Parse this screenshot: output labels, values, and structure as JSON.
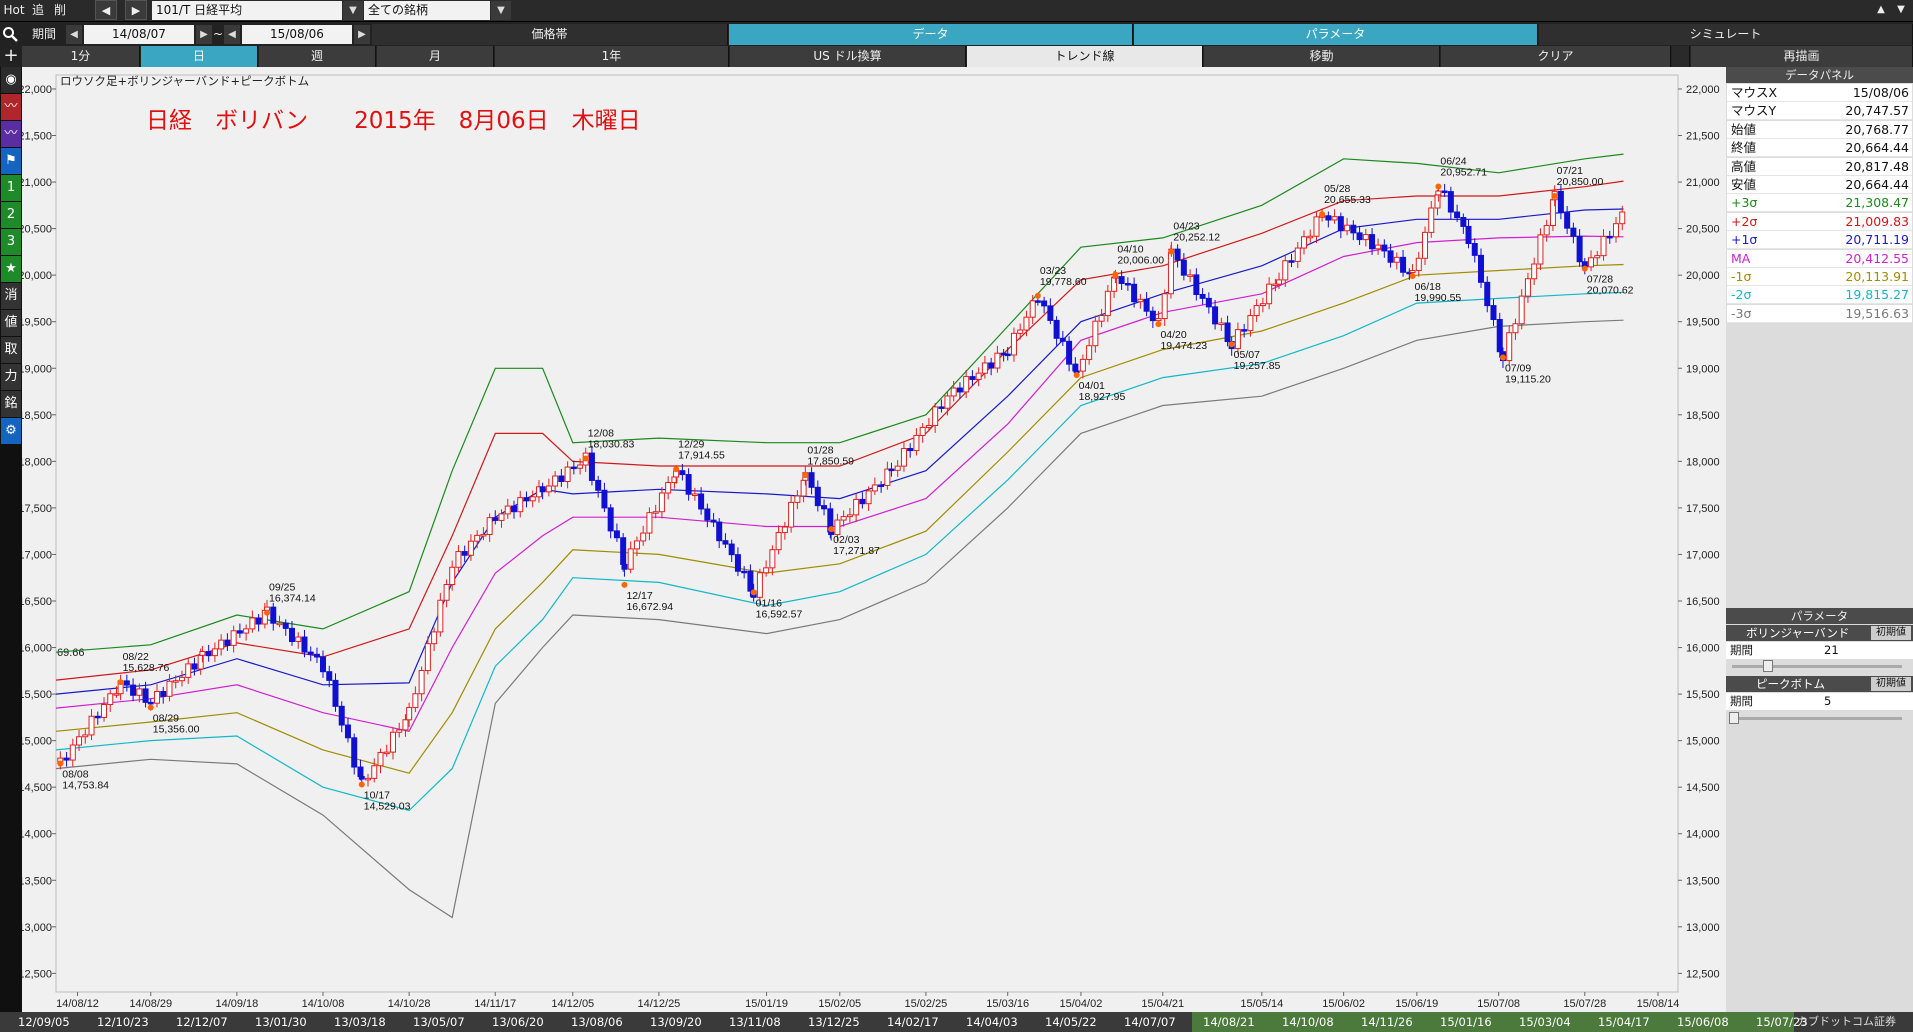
{
  "toolbar": {
    "hot": "Hot",
    "add": "追",
    "del": "削",
    "symbol": "101/T 日経平均",
    "universe": "全ての銘柄",
    "period_label": "期間",
    "date_from": "14/08/07",
    "tilde": "~",
    "date_to": "15/08/06",
    "tab_price": "価格帯",
    "tab_data": "データ",
    "tab_param": "パラメータ",
    "tab_sim": "シミュレート",
    "interval_1min": "1分",
    "interval_day": "日",
    "interval_week": "週",
    "interval_month": "月",
    "range_1y": "1年",
    "usd": "US ドル換算",
    "trendline": "トレンド線",
    "move": "移動",
    "clear": "クリア",
    "redraw": "再描画"
  },
  "leftbar": [
    "消",
    "値",
    "取",
    "力",
    "銘"
  ],
  "chart_data": {
    "type": "candlestick",
    "title": "ロウソク足+ボリンジャーバンド+ピークボトム",
    "annotation": "日経　ボリバン　　2015年　8月06日　木曜日",
    "y_ticks": [
      22000,
      21500,
      21000,
      20500,
      20000,
      19500,
      19000,
      18500,
      18000,
      17500,
      17000,
      16500,
      16000,
      15500,
      15000,
      14500,
      14000,
      13500,
      13000,
      12500
    ],
    "y_range": [
      12300,
      22150
    ],
    "y_cutoff_label": "69.66",
    "x_ticks": [
      "14/08/12",
      "14/08/29",
      "14/09/18",
      "14/10/08",
      "14/10/28",
      "14/11/17",
      "14/12/05",
      "14/12/25",
      "15/01/19",
      "15/02/05",
      "15/02/25",
      "15/03/16",
      "15/04/02",
      "15/04/21",
      "15/05/14",
      "15/06/02",
      "15/06/19",
      "15/07/08",
      "15/07/28",
      "15/08/14"
    ],
    "bands": {
      "names": [
        "+3σ",
        "+2σ",
        "+1σ",
        "MA",
        "-1σ",
        "-2σ",
        "-3σ"
      ],
      "colors": [
        "#1a8a1a",
        "#d01818",
        "#1a1ac8",
        "#d020d0",
        "#a08c00",
        "#10b8c8",
        "#7a7a7a"
      ],
      "anchors_x": [
        "14/08/07",
        "14/08/29",
        "14/09/18",
        "14/10/08",
        "14/10/28",
        "14/11/07",
        "14/11/17",
        "14/11/28",
        "14/12/05",
        "14/12/25",
        "15/01/19",
        "15/02/05",
        "15/02/25",
        "15/03/16",
        "15/04/02",
        "15/04/21",
        "15/05/14",
        "15/06/02",
        "15/06/19",
        "15/07/08",
        "15/07/28",
        "15/08/06"
      ],
      "plus3": [
        15950,
        16030,
        16350,
        16200,
        16600,
        17900,
        19000,
        19000,
        18200,
        18250,
        18200,
        18200,
        18500,
        19450,
        20300,
        20400,
        20750,
        21250,
        21200,
        21100,
        21250,
        21300
      ],
      "plus2": [
        15650,
        15760,
        16050,
        15900,
        16200,
        17200,
        18300,
        18300,
        18000,
        17950,
        17950,
        17950,
        18300,
        19200,
        19950,
        20100,
        20450,
        20800,
        20850,
        20850,
        20950,
        21010
      ],
      "plus1": [
        15500,
        15600,
        15880,
        15600,
        15620,
        16700,
        17400,
        17700,
        17650,
        17700,
        17650,
        17600,
        17900,
        18700,
        19500,
        19800,
        20100,
        20500,
        20600,
        20600,
        20700,
        20711
      ],
      "ma": [
        15350,
        15450,
        15600,
        15300,
        15100,
        16000,
        16800,
        17200,
        17400,
        17400,
        17300,
        17300,
        17600,
        18400,
        19300,
        19600,
        19800,
        20200,
        20350,
        20400,
        20420,
        20412
      ],
      "minus1": [
        15100,
        15200,
        15300,
        14900,
        14650,
        15300,
        16200,
        16700,
        17050,
        17000,
        16800,
        16900,
        17250,
        18100,
        18900,
        19200,
        19400,
        19700,
        20000,
        20050,
        20100,
        20114
      ],
      "minus2": [
        14900,
        15000,
        15050,
        14500,
        14250,
        14700,
        15800,
        16300,
        16750,
        16700,
        16450,
        16600,
        17000,
        17800,
        18600,
        18900,
        19050,
        19350,
        19700,
        19750,
        19800,
        19815
      ],
      "minus3": [
        14700,
        14800,
        14750,
        14200,
        13400,
        13100,
        15400,
        16000,
        16350,
        16300,
        16150,
        16300,
        16700,
        17500,
        18300,
        18600,
        18700,
        19000,
        19300,
        19450,
        19500,
        19516
      ]
    },
    "price": {
      "x": [
        "14/08/08",
        "14/08/22",
        "14/08/29",
        "14/09/10",
        "14/09/25",
        "14/10/08",
        "14/10/17",
        "14/10/28",
        "14/11/07",
        "14/11/17",
        "14/11/28",
        "14/12/08",
        "14/12/17",
        "14/12/29",
        "15/01/08",
        "15/01/16",
        "15/01/28",
        "15/02/03",
        "15/02/17",
        "15/03/02",
        "15/03/16",
        "15/03/23",
        "15/04/01",
        "15/04/10",
        "15/04/20",
        "15/04/23",
        "15/05/07",
        "15/05/18",
        "15/05/28",
        "15/06/10",
        "15/06/18",
        "15/06/24",
        "15/07/01",
        "15/07/09",
        "15/07/21",
        "15/07/28",
        "15/08/06"
      ],
      "close": [
        14753,
        15620,
        15420,
        15900,
        16374,
        15800,
        14529,
        15300,
        16900,
        17400,
        17700,
        18030,
        16900,
        17914,
        17200,
        16592,
        17850,
        17271,
        17900,
        18700,
        19200,
        19778,
        18927,
        20006,
        19474,
        20252,
        19257,
        20000,
        20655,
        20300,
        19990,
        20952,
        20400,
        19115,
        20850,
        20070,
        20664
      ]
    },
    "markers": [
      {
        "label": "08/08",
        "value": "14,753.84",
        "x": "14/08/08",
        "y": 14753.84,
        "type": "bottom"
      },
      {
        "label": "08/22",
        "value": "15,628.76",
        "x": "14/08/22",
        "y": 15628.76,
        "type": "top"
      },
      {
        "label": "08/29",
        "value": "15,356.00",
        "x": "14/08/29",
        "y": 15356.0,
        "type": "bottom"
      },
      {
        "label": "09/25",
        "value": "16,374.14",
        "x": "14/09/25",
        "y": 16374.14,
        "type": "top"
      },
      {
        "label": "10/17",
        "value": "14,529.03",
        "x": "14/10/17",
        "y": 14529.03,
        "type": "bottom"
      },
      {
        "label": "12/08",
        "value": "18,030.83",
        "x": "14/12/08",
        "y": 18030.83,
        "type": "top"
      },
      {
        "label": "12/17",
        "value": "16,672.94",
        "x": "14/12/17",
        "y": 16672.94,
        "type": "bottom"
      },
      {
        "label": "12/29",
        "value": "17,914.55",
        "x": "14/12/29",
        "y": 17914.55,
        "type": "top"
      },
      {
        "label": "01/16",
        "value": "16,592.57",
        "x": "15/01/16",
        "y": 16592.57,
        "type": "bottom"
      },
      {
        "label": "01/28",
        "value": "17,850.59",
        "x": "15/01/28",
        "y": 17850.59,
        "type": "top"
      },
      {
        "label": "02/03",
        "value": "17,271.87",
        "x": "15/02/03",
        "y": 17271.87,
        "type": "bottom"
      },
      {
        "label": "03/23",
        "value": "19,778.60",
        "x": "15/03/23",
        "y": 19778.6,
        "type": "top"
      },
      {
        "label": "04/01",
        "value": "18,927.95",
        "x": "15/04/01",
        "y": 18927.95,
        "type": "bottom"
      },
      {
        "label": "04/10",
        "value": "20,006.00",
        "x": "15/04/10",
        "y": 20006.0,
        "type": "top"
      },
      {
        "label": "04/20",
        "value": "19,474.23",
        "x": "15/04/20",
        "y": 19474.23,
        "type": "bottom"
      },
      {
        "label": "04/23",
        "value": "20,252.12",
        "x": "15/04/23",
        "y": 20252.12,
        "type": "top"
      },
      {
        "label": "05/07",
        "value": "19,257.85",
        "x": "15/05/07",
        "y": 19257.85,
        "type": "bottom"
      },
      {
        "label": "05/28",
        "value": "20,655.33",
        "x": "15/05/28",
        "y": 20655.33,
        "type": "top"
      },
      {
        "label": "06/18",
        "value": "19,990.55",
        "x": "15/06/18",
        "y": 19990.55,
        "type": "bottom"
      },
      {
        "label": "06/24",
        "value": "20,952.71",
        "x": "15/06/24",
        "y": 20952.71,
        "type": "top"
      },
      {
        "label": "07/09",
        "value": "19,115.20",
        "x": "15/07/09",
        "y": 19115.2,
        "type": "bottom"
      },
      {
        "label": "07/21",
        "value": "20,850.00",
        "x": "15/07/21",
        "y": 20850.0,
        "type": "top"
      },
      {
        "label": "07/28",
        "value": "20,070.62",
        "x": "15/07/28",
        "y": 20070.62,
        "type": "bottom"
      }
    ]
  },
  "panel": {
    "data_header": "データパネル",
    "rows": [
      {
        "k": "マウスX",
        "v": "15/08/06",
        "color": "#111111"
      },
      {
        "k": "マウスY",
        "v": "20,747.57",
        "color": "#111111"
      },
      {
        "k": "始値",
        "v": "20,768.77",
        "color": "#111111"
      },
      {
        "k": "終値",
        "v": "20,664.44",
        "color": "#111111"
      },
      {
        "k": "高値",
        "v": "20,817.48",
        "color": "#111111"
      },
      {
        "k": "安値",
        "v": "20,664.44",
        "color": "#111111"
      },
      {
        "k": "+3σ",
        "v": "21,308.47",
        "color": "#1a8a1a"
      },
      {
        "k": "+2σ",
        "v": "21,009.83",
        "color": "#d01818"
      },
      {
        "k": "+1σ",
        "v": "20,711.19",
        "color": "#1a1ac8"
      },
      {
        "k": "MA",
        "v": "20,412.55",
        "color": "#d020d0"
      },
      {
        "k": "-1σ",
        "v": "20,113.91",
        "color": "#a08c00"
      },
      {
        "k": "-2σ",
        "v": "19,815.27",
        "color": "#10b8c8"
      },
      {
        "k": "-3σ",
        "v": "19,516.63",
        "color": "#7a7a7a"
      }
    ],
    "param_header": "パラメータ",
    "bb_label": "ボリンジャーバンド",
    "bb_reset": "初期値",
    "bb_period_label": "期間",
    "bb_period": "21",
    "pb_label": "ピークボトム",
    "pb_reset": "初期値",
    "pb_period_label": "期間",
    "pb_period": "5"
  },
  "bottom_dates": [
    "12/09/05",
    "12/10/23",
    "12/12/07",
    "13/01/30",
    "13/03/18",
    "13/05/07",
    "13/06/20",
    "13/08/06",
    "13/09/20",
    "13/11/08",
    "13/12/25",
    "14/02/17",
    "14/04/03",
    "14/05/22",
    "14/07/07",
    "14/08/21",
    "14/10/08",
    "14/11/26",
    "15/01/16",
    "15/03/04",
    "15/04/17",
    "15/06/08",
    "15/07/23"
  ],
  "brand": "カブドットコム証券"
}
